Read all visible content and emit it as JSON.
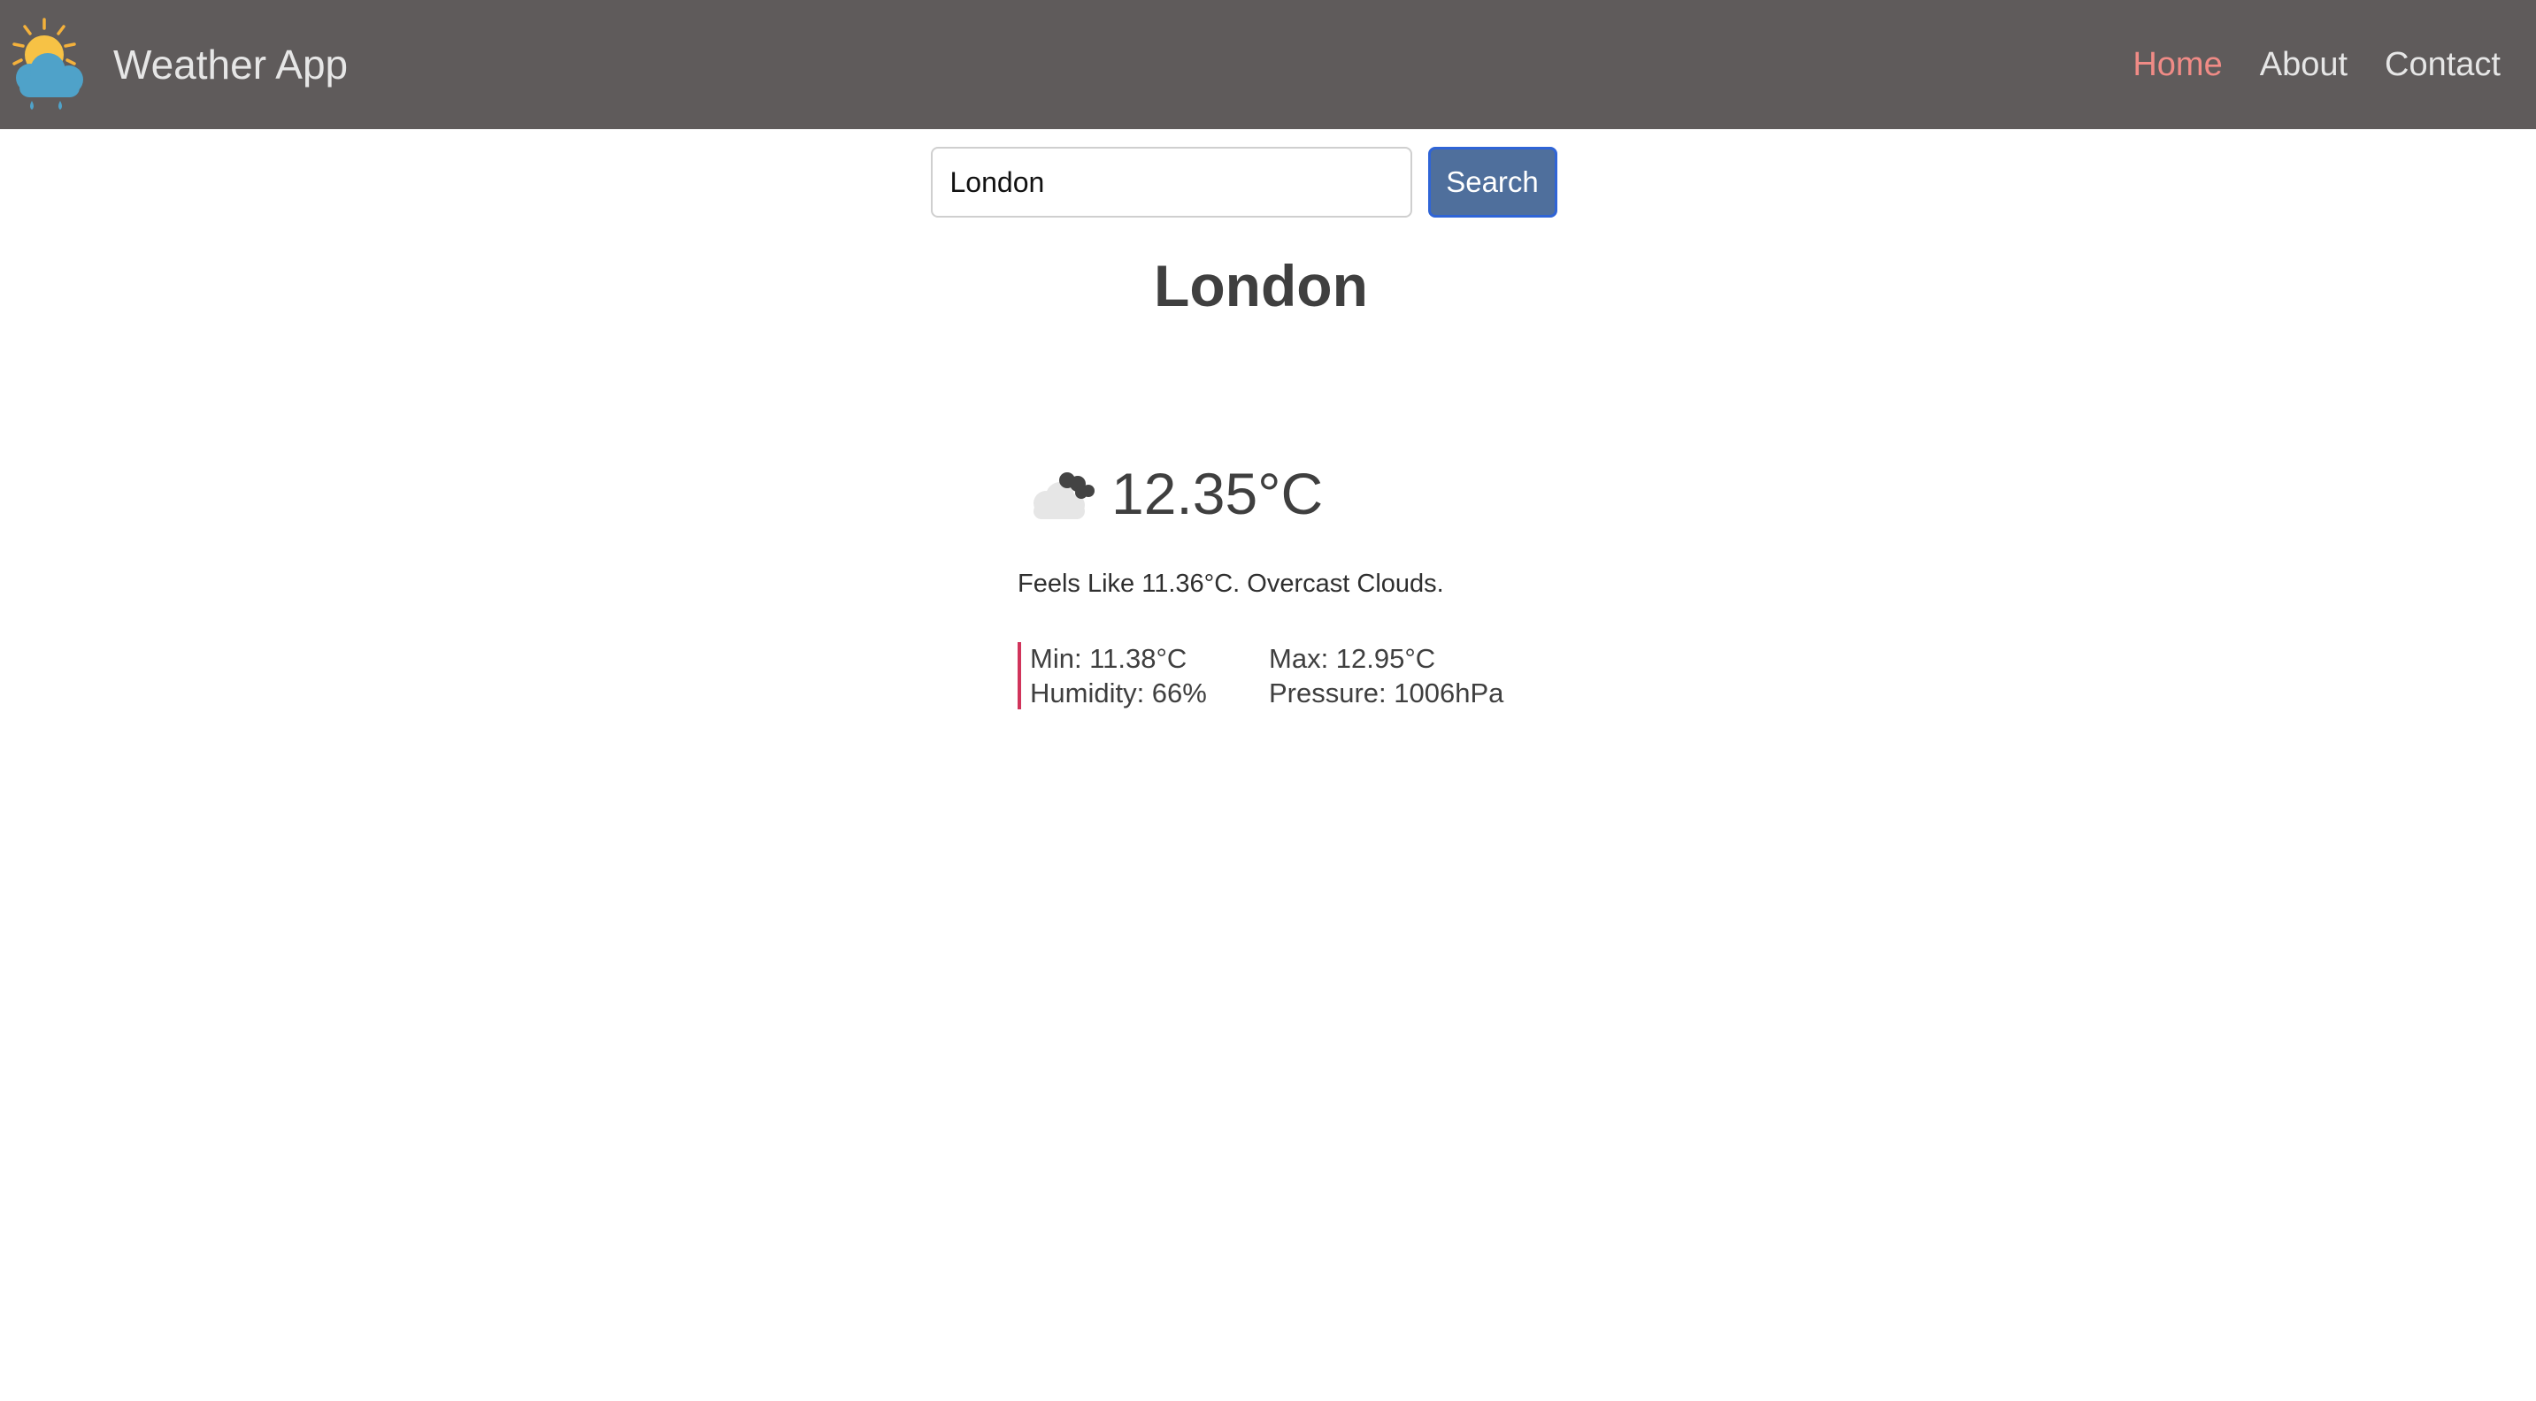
{
  "nav": {
    "title": "Weather App",
    "links": [
      {
        "label": "Home",
        "active": true
      },
      {
        "label": "About",
        "active": false
      },
      {
        "label": "Contact",
        "active": false
      }
    ]
  },
  "search": {
    "value": "London",
    "button_label": "Search"
  },
  "weather": {
    "city": "London",
    "icon": "overcast-clouds-icon",
    "temperature": "12.35°C",
    "summary": "Feels Like 11.36°C. Overcast Clouds.",
    "min": "Min: 11.38°C",
    "max": "Max: 12.95°C",
    "humidity": "Humidity: 66%",
    "pressure": "Pressure: 1006hPa"
  },
  "colors": {
    "navbar_bg": "#5f5b5b",
    "nav_active": "#f08b86",
    "search_button": "#4f6f9c",
    "details_accent": "#d1345b"
  }
}
